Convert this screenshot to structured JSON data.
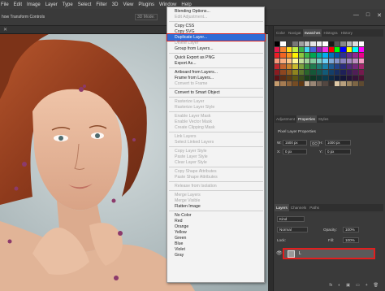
{
  "menubar": {
    "items": [
      "File",
      "Edit",
      "Image",
      "Layer",
      "Type",
      "Select",
      "Filter",
      "3D",
      "View",
      "Plugins",
      "Window",
      "Help"
    ]
  },
  "optionsbar": {
    "label": "how Transform Controls",
    "mode_label": "3D Mode:",
    "window_controls": [
      "—",
      "□",
      "✕"
    ]
  },
  "context_menu": {
    "items": [
      {
        "label": "Blending Options...",
        "disabled": false
      },
      {
        "label": "Edit Adjustment...",
        "disabled": true
      },
      {
        "sep": true
      },
      {
        "label": "Copy CSS",
        "disabled": false
      },
      {
        "label": "Copy SVG",
        "disabled": false
      },
      {
        "label": "Duplicate Layer...",
        "disabled": false,
        "highlighted": true
      },
      {
        "label": "Delete Layer",
        "disabled": true
      },
      {
        "label": "Group from Layers...",
        "disabled": false
      },
      {
        "sep": true
      },
      {
        "label": "Quick Export as PNG",
        "disabled": false
      },
      {
        "label": "Export As...",
        "disabled": false
      },
      {
        "sep": true
      },
      {
        "label": "Artboard from Layers...",
        "disabled": false
      },
      {
        "label": "Frame from Layers...",
        "disabled": false
      },
      {
        "label": "Convert to Frame",
        "disabled": true
      },
      {
        "sep": true
      },
      {
        "label": "Convert to Smart Object",
        "disabled": false
      },
      {
        "sep": true
      },
      {
        "label": "Rasterize Layer",
        "disabled": true
      },
      {
        "label": "Rasterize Layer Style",
        "disabled": true
      },
      {
        "sep": true
      },
      {
        "label": "Enable Layer Mask",
        "disabled": true
      },
      {
        "label": "Enable Vector Mask",
        "disabled": true
      },
      {
        "label": "Create Clipping Mask",
        "disabled": true
      },
      {
        "sep": true
      },
      {
        "label": "Link Layers",
        "disabled": true
      },
      {
        "label": "Select Linked Layers",
        "disabled": true
      },
      {
        "sep": true
      },
      {
        "label": "Copy Layer Style",
        "disabled": true
      },
      {
        "label": "Paste Layer Style",
        "disabled": true
      },
      {
        "label": "Clear Layer Style",
        "disabled": true
      },
      {
        "sep": true
      },
      {
        "label": "Copy Shape Attributes",
        "disabled": true
      },
      {
        "label": "Paste Shape Attributes",
        "disabled": true
      },
      {
        "sep": true
      },
      {
        "label": "Release from Isolation",
        "disabled": true
      },
      {
        "sep": true
      },
      {
        "label": "Merge Layers",
        "disabled": true
      },
      {
        "label": "Merge Visible",
        "disabled": true
      },
      {
        "label": "Flatten Image",
        "disabled": false
      },
      {
        "sep": true
      },
      {
        "label": "No Color",
        "disabled": false
      },
      {
        "label": "Red",
        "disabled": false
      },
      {
        "label": "Orange",
        "disabled": false
      },
      {
        "label": "Yellow",
        "disabled": false
      },
      {
        "label": "Green",
        "disabled": false
      },
      {
        "label": "Blue",
        "disabled": false
      },
      {
        "label": "Violet",
        "disabled": false
      },
      {
        "label": "Gray",
        "disabled": false
      }
    ]
  },
  "swatches_panel": {
    "tabs": [
      "Color",
      "Navigat",
      "Swatches",
      "Histogra",
      "History"
    ],
    "active_tab": "Swatches",
    "colors": [
      [
        "#000000",
        "#ffffff",
        "#3c3c3c",
        "#777777",
        "#a0a0a0",
        "#c8c8c8",
        "#e4e4e4",
        "#f0f0f0",
        "#ffffff",
        "#1a1a1a",
        "#555555",
        "#888888",
        "#bbbbbb",
        "#dddddd",
        "#ffffff"
      ],
      [
        "#e6194b",
        "#f58231",
        "#ffe119",
        "#bfef45",
        "#3cb44b",
        "#42d4f4",
        "#4363d8",
        "#911eb4",
        "#f032e6",
        "#ff0000",
        "#00ff00",
        "#0000ff",
        "#ffff00",
        "#00ffff",
        "#ff00ff"
      ],
      [
        "#ed1c24",
        "#f26522",
        "#f7941d",
        "#fff200",
        "#8dc63f",
        "#39b54a",
        "#00a651",
        "#00a99d",
        "#00aeef",
        "#0072bc",
        "#0054a6",
        "#2e3192",
        "#662d91",
        "#92278f",
        "#ec008c"
      ],
      [
        "#f7977a",
        "#f9ad81",
        "#fdc68a",
        "#fff79a",
        "#c4df9b",
        "#a3d39c",
        "#82ca9d",
        "#7bcdc8",
        "#6ecff6",
        "#7ea7d8",
        "#8493ca",
        "#8882be",
        "#a187be",
        "#bc8dbf",
        "#f49ac2"
      ],
      [
        "#c1272d",
        "#c4622d",
        "#c9822b",
        "#c9b92d",
        "#7fa23f",
        "#3a8e3e",
        "#1f7a4f",
        "#1c7b73",
        "#1a7fa8",
        "#1c5b94",
        "#22418a",
        "#2a2d7c",
        "#4e2a7c",
        "#712a7a",
        "#a3256c"
      ],
      [
        "#8c1b20",
        "#8d4620",
        "#915d1e",
        "#8f841f",
        "#5a742c",
        "#29652c",
        "#155738",
        "#135852",
        "#125b78",
        "#143f69",
        "#182e62",
        "#1e2058",
        "#371e58",
        "#501e57",
        "#741a4d"
      ],
      [
        "#5a1114",
        "#5b2d14",
        "#5d3c13",
        "#5c5514",
        "#3a4b1c",
        "#1a411c",
        "#0d3824",
        "#0c3935",
        "#0b3b4d",
        "#0d2944",
        "#101d3f",
        "#131539",
        "#231339",
        "#341338",
        "#4b1132"
      ],
      [
        "#c69c6d",
        "#a67c52",
        "#8c6239",
        "#754c24",
        "#603913",
        "#c7b299",
        "#998675",
        "#736357",
        "#534741",
        "#362f2d",
        "#e0c9a6",
        "#b8a07e",
        "#9c845f",
        "#7d6645",
        "#5e4a30"
      ]
    ]
  },
  "properties_panel": {
    "tabs": [
      "Adjustment",
      "Properties",
      "Styles"
    ],
    "active_tab": "Properties",
    "title": "Pixel Layer Properties",
    "w_label": "W:",
    "w_value": "1500 px",
    "link_label": "GO",
    "h_label": "H:",
    "h_value": "1000 px",
    "x_label": "X:",
    "x_value": "0 px",
    "y_label": "Y:",
    "y_value": "0 px"
  },
  "layers_panel": {
    "tabs": [
      "Layers",
      "Channels",
      "Paths"
    ],
    "active_tab": "Layers",
    "filter_label": "Kind",
    "blend_mode": "Normal",
    "opacity_label": "Opacity:",
    "opacity_value": "100%",
    "lock_label": "Lock:",
    "fill_label": "Fill:",
    "fill_value": "100%",
    "layer_name": "L",
    "footer_icons": [
      "fx",
      "◐",
      "▣",
      "▭",
      "+",
      "🗑"
    ]
  },
  "colors": {
    "highlight": "#2f6cd6",
    "annotation_red": "#e31e1e",
    "panel_bg": "#393939",
    "menu_bg": "#f3f3f3"
  }
}
